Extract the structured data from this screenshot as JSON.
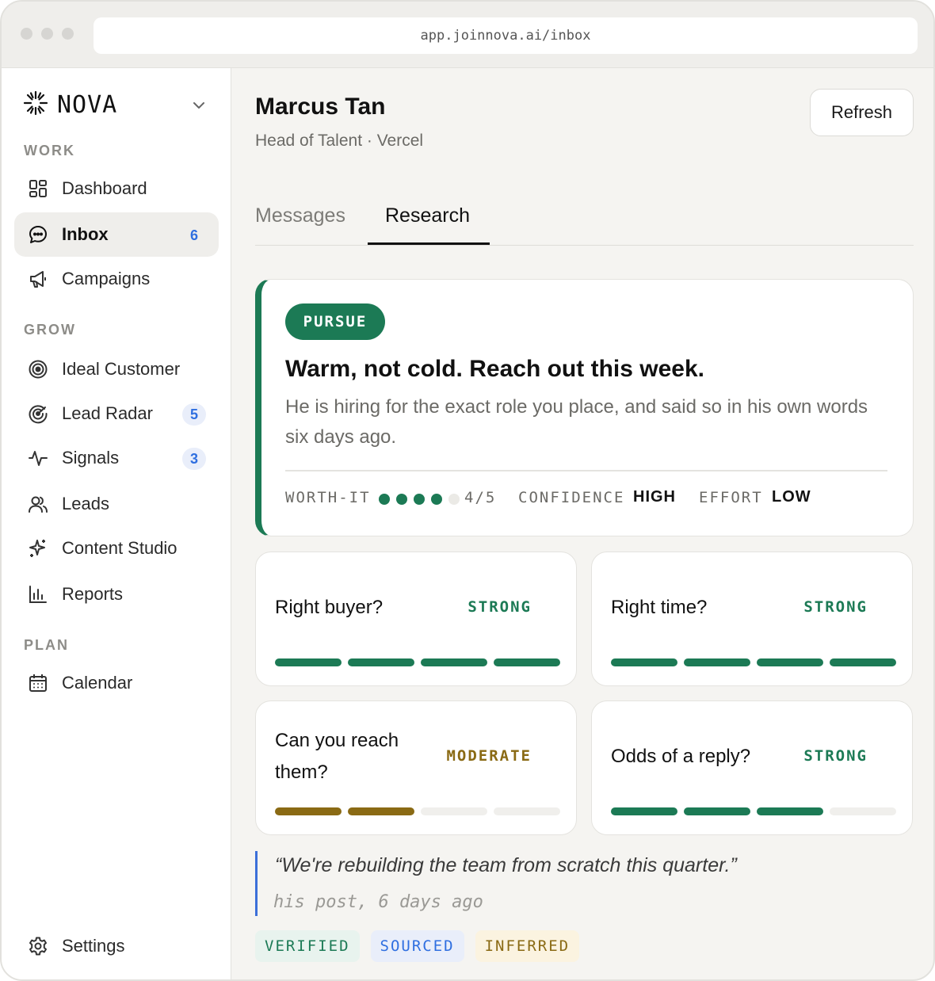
{
  "browser": {
    "url": "app.joinnova.ai/inbox"
  },
  "sidebar": {
    "brand": "NOVA",
    "sections": {
      "work": "WORK",
      "grow": "GROW",
      "plan": "PLAN"
    },
    "items": [
      {
        "label": "Dashboard",
        "icon": "dashboard-grid-icon"
      },
      {
        "label": "Inbox",
        "icon": "chat-bubble-icon",
        "badge": "6",
        "active": true
      },
      {
        "label": "Campaigns",
        "icon": "megaphone-icon"
      },
      {
        "label": "Ideal Customer",
        "icon": "target-icon"
      },
      {
        "label": "Lead Radar",
        "icon": "radar-icon",
        "badge": "5"
      },
      {
        "label": "Signals",
        "icon": "pulse-icon",
        "badge": "3"
      },
      {
        "label": "Leads",
        "icon": "users-icon"
      },
      {
        "label": "Content Studio",
        "icon": "sparkle-icon"
      },
      {
        "label": "Reports",
        "icon": "bar-chart-icon"
      },
      {
        "label": "Calendar",
        "icon": "calendar-icon"
      },
      {
        "label": "Settings",
        "icon": "gear-icon"
      }
    ]
  },
  "header": {
    "name": "Marcus Tan",
    "role": "Head of Talent · Vercel",
    "refresh_label": "Refresh"
  },
  "tabs": [
    {
      "label": "Messages",
      "active": false
    },
    {
      "label": "Research",
      "active": true
    }
  ],
  "verdict": {
    "pill": "PURSUE",
    "title": "Warm, not cold. Reach out this week.",
    "description": "He is hiring for the exact role you place, and said so in his own words six days ago.",
    "worth_label": "WORTH-IT",
    "worth_score": 4,
    "worth_max": 5,
    "worth_text": "4/5",
    "confidence_label": "CONFIDENCE",
    "confidence_value": "HIGH",
    "effort_label": "EFFORT",
    "effort_value": "LOW"
  },
  "cards": [
    {
      "question": "Right buyer?",
      "rating": "STRONG",
      "filled": 4,
      "total": 4,
      "color": "#1c7a55"
    },
    {
      "question": "Right time?",
      "rating": "STRONG",
      "filled": 4,
      "total": 4,
      "color": "#1c7a55"
    },
    {
      "question": "Can you reach them?",
      "rating": "MODERATE",
      "filled": 2,
      "total": 4,
      "color": "#8a6a14"
    },
    {
      "question": "Odds of a reply?",
      "rating": "STRONG",
      "filled": 3,
      "total": 4,
      "color": "#1c7a55"
    }
  ],
  "quote": {
    "text": "“We're rebuilding the team from scratch this quarter.”",
    "source": "his post, 6 days ago"
  },
  "chips": [
    {
      "label": "VERIFIED",
      "fg": "#1c7a55",
      "bg": "#e8f3ee"
    },
    {
      "label": "SOURCED",
      "fg": "#2f6fe0",
      "bg": "#e9eefa"
    },
    {
      "label": "INFERRED",
      "fg": "#8a6a14",
      "bg": "#fbf3e0"
    }
  ],
  "colors": {
    "accent_green": "#1c7a55",
    "accent_blue": "#2f6fe0",
    "accent_amber": "#8a6a14"
  }
}
